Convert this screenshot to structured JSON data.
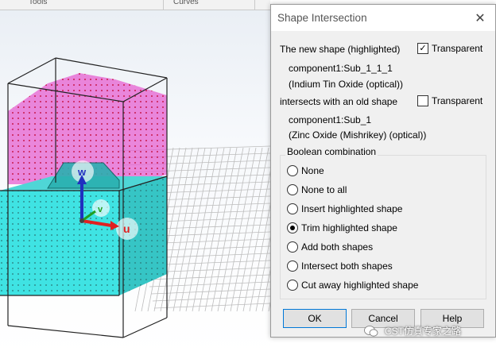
{
  "ribbon": {
    "labels": [
      "Tools",
      "Curves"
    ]
  },
  "viewport": {
    "axes": {
      "w": "w",
      "v": "v",
      "u": "u"
    },
    "colors": {
      "substrate": "#3fe3e3",
      "layer_top": "#e65fd0",
      "axis_u": "#e02020",
      "axis_w": "#2030c0",
      "axis_v": "#20a020"
    }
  },
  "dialog": {
    "title": "Shape Intersection",
    "new_shape_label": "The new shape (highlighted)",
    "transparent_label_1": "Transparent",
    "transparent_1_checked": true,
    "new_component": "component1:Sub_1_1_1",
    "new_material": "(Indium Tin Oxide (optical))",
    "intersects_label": "intersects with an old shape",
    "transparent_label_2": "Transparent",
    "transparent_2_checked": false,
    "old_component": "component1:Sub_1",
    "old_material": "(Zinc Oxide (Mishrikey) (optical))",
    "group_label": "Boolean combination",
    "options": [
      {
        "label": "None",
        "selected": false
      },
      {
        "label": "None to all",
        "selected": false
      },
      {
        "label": "Insert highlighted shape",
        "selected": false
      },
      {
        "label": "Trim highlighted shape",
        "selected": true
      },
      {
        "label": "Add both shapes",
        "selected": false
      },
      {
        "label": "Intersect both shapes",
        "selected": false
      },
      {
        "label": "Cut away highlighted shape",
        "selected": false
      }
    ],
    "buttons": {
      "ok": "OK",
      "cancel": "Cancel",
      "help": "Help"
    }
  },
  "watermark": {
    "text": "CST仿真专家之路"
  }
}
